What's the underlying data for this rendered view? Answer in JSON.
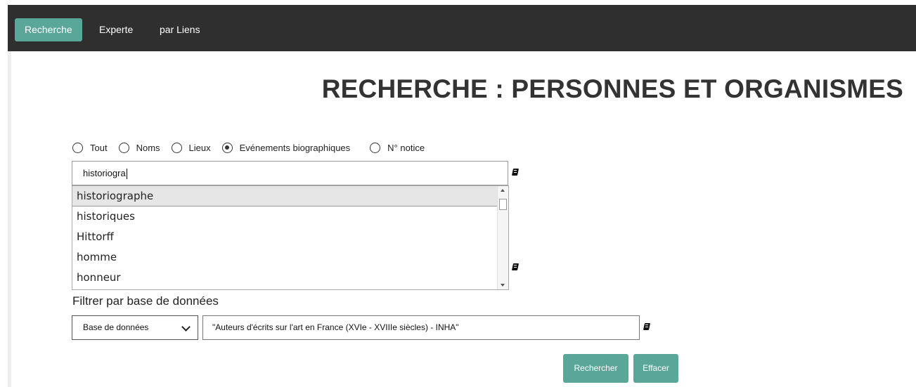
{
  "nav": {
    "items": [
      {
        "label": "Recherche",
        "active": true
      },
      {
        "label": "Experte",
        "active": false
      },
      {
        "label": "par Liens",
        "active": false
      }
    ]
  },
  "page": {
    "title": "RECHERCHE : PERSONNES ET ORGANISMES"
  },
  "search_scope": {
    "options": [
      {
        "label": "Tout",
        "checked": false
      },
      {
        "label": "Noms",
        "checked": false
      },
      {
        "label": "Lieux",
        "checked": false
      },
      {
        "label": "Evénements biographiques",
        "checked": true
      },
      {
        "label": "N° notice",
        "checked": false
      }
    ]
  },
  "search": {
    "value": "historiogra"
  },
  "autocomplete": {
    "items": [
      "historiographe",
      "historiques",
      "Hittorff",
      "homme",
      "honneur"
    ],
    "highlighted_index": 0
  },
  "filter": {
    "label": "Filtrer par base de données",
    "select_value": "Base de données",
    "value": "\"Auteurs d'écrits sur l'art en France (XVIe - XVIIIe siècles) - INHA\""
  },
  "actions": {
    "search_label": "Rechercher",
    "clear_label": "Effacer"
  },
  "colors": {
    "navbar": "#2f2f2f",
    "accent": "#5aa79a"
  },
  "icons": [
    "book-icon"
  ]
}
